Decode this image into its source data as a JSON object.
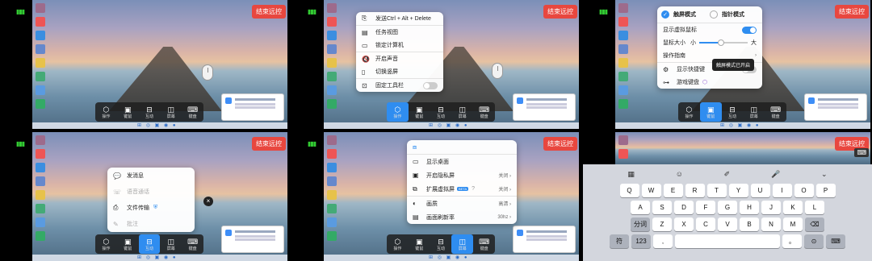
{
  "end_button": "结束远控",
  "toolbar": [
    {
      "id": "ops",
      "label": "操作",
      "icon": "⬡"
    },
    {
      "id": "keys",
      "label": "键鼠",
      "icon": "▣"
    },
    {
      "id": "interact",
      "label": "互动",
      "icon": "⊟"
    },
    {
      "id": "screen",
      "label": "屏幕",
      "icon": "◫"
    },
    {
      "id": "keyboard",
      "label": "键盘",
      "icon": "⌨"
    }
  ],
  "panel2": {
    "items": [
      {
        "label": "发送Ctrl + Alt + Delete",
        "icon": "⎘"
      },
      {
        "label": "任务视图",
        "icon": "▤"
      },
      {
        "label": "锁定计算机",
        "icon": "▭"
      },
      {
        "label": "开启声音",
        "icon": "🔇"
      },
      {
        "label": "切换竖屏",
        "icon": "▯"
      },
      {
        "label": "固定工具栏",
        "icon": "⊡",
        "toggle": false
      }
    ]
  },
  "panel3": {
    "mode_touch": "触屏模式",
    "mode_pointer": "指针模式",
    "show_mouse": "显示虚拟鼠标",
    "mouse_size": "鼠标大小",
    "size_small": "小",
    "size_big": "大",
    "mouse_size_value": 0.45,
    "guide": "操作指南",
    "shortcuts": "显示快捷键",
    "game_keyboard": "游戏键盘",
    "tooltip": "触屏模式已开启"
  },
  "panel4": {
    "items": [
      {
        "label": "发消息",
        "icon": "💬",
        "muted": false
      },
      {
        "label": "语音通话",
        "icon": "☏",
        "muted": true
      },
      {
        "label": "文件传输",
        "icon": "⎙",
        "muted": false
      },
      {
        "label": "批注",
        "icon": "✎",
        "muted": true
      }
    ]
  },
  "panel5": {
    "items": [
      {
        "label": "显示桌面",
        "icon": "▭",
        "right": ""
      },
      {
        "label": "开启隐私屏",
        "icon": "▣",
        "right": "关闭 ›"
      },
      {
        "label": "扩展虚拟屏",
        "icon": "⧉",
        "right": "关闭 ›",
        "badge": "BETA"
      },
      {
        "label": "画质",
        "icon": "◐",
        "right": "高清 ›"
      },
      {
        "label": "画面刷新率",
        "icon": "▤",
        "right": "30hz ›"
      }
    ]
  },
  "keyboard": {
    "row1": [
      "Q",
      "W",
      "E",
      "R",
      "T",
      "Y",
      "U",
      "I",
      "O",
      "P"
    ],
    "row2": [
      "A",
      "S",
      "D",
      "F",
      "G",
      "H",
      "J",
      "K",
      "L"
    ],
    "row3": [
      "分词",
      "Z",
      "X",
      "C",
      "V",
      "B",
      "N",
      "M",
      "⌫"
    ],
    "row4": [
      "符",
      "123",
      ",",
      "",
      "。",
      "⊙",
      "⌨"
    ]
  }
}
